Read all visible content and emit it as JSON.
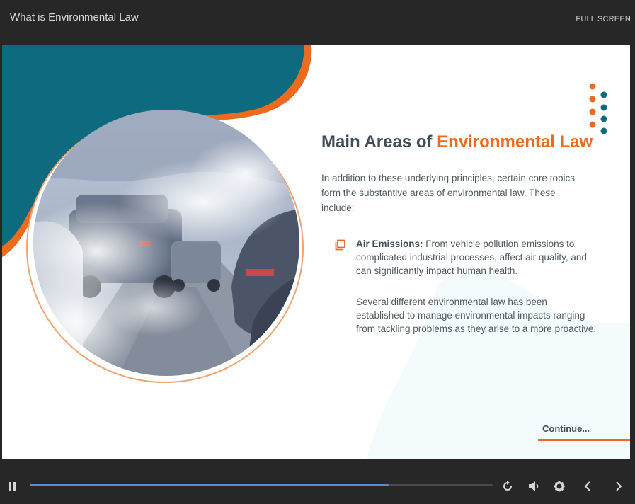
{
  "header": {
    "course_title": "What is Environmental Law",
    "fullscreen_label": "FULL SCREEN"
  },
  "slide": {
    "heading_part1": "Main Areas of ",
    "heading_accent": "Environmental Law",
    "intro": "In addition to these underlying principles, certain core topics form the substantive areas of environmental law. These include:",
    "bullet": {
      "icon": "copy-icon",
      "title": "Air Emissions:",
      "text": " From vehicle pollution emissions to complicated industrial processes, affect air quality, and can significantly impact human health."
    },
    "paragraph2": "Several different environmental law has been established to manage environmental impacts ranging from tackling problems as they arise to a more proactive.",
    "continue_label": "Continue...",
    "image": "traffic-smog-photo"
  },
  "controls": {
    "progress": 0.775,
    "icons": [
      "pause-icon",
      "replay-icon",
      "volume-icon",
      "settings-gear-icon",
      "prev-arrow-icon",
      "next-arrow-icon"
    ]
  },
  "colors": {
    "accent": "#ee6a1e",
    "teal": "#0e6a7e",
    "heading": "#3e4e54",
    "progress": "#5b8bd0"
  }
}
